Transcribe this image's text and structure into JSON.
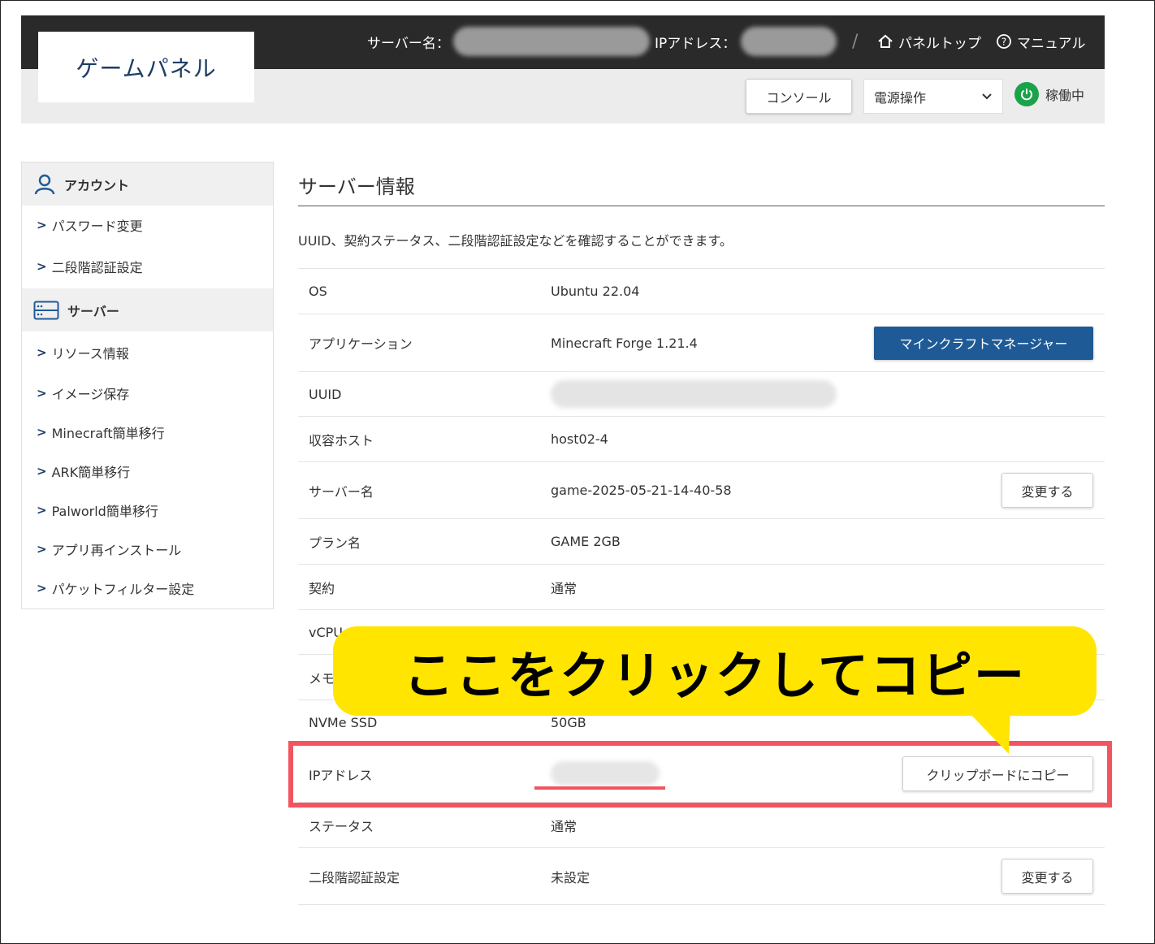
{
  "header": {
    "logo": "ゲームパネル",
    "server_name_label": "サーバー名：",
    "ip_label": "IPアドレス：",
    "panel_top": "パネルトップ",
    "manual": "マニュアル",
    "console_button": "コンソール",
    "power_select": "電源操作",
    "status_text": "稼働中",
    "colors": {
      "dark_bar": "#2a2a2a",
      "logo_text": "#1f3d66",
      "status_green": "#1aa34a"
    }
  },
  "sidebar": {
    "account_heading": "アカウント",
    "account_items": [
      "パスワード変更",
      "二段階認証設定"
    ],
    "server_heading": "サーバー",
    "server_items": [
      "リソース情報",
      "イメージ保存",
      "Minecraft簡単移行",
      "ARK簡単移行",
      "Palworld簡単移行",
      "アプリ再インストール",
      "パケットフィルター設定"
    ]
  },
  "main": {
    "title": "サーバー情報",
    "description": "UUID、契約ステータス、二段階認証設定などを確認することができます。",
    "rows": [
      {
        "key": "OS",
        "value": "Ubuntu 22.04"
      },
      {
        "key": "アプリケーション",
        "value": "Minecraft Forge 1.21.4",
        "button": "マインクラフトマネージャー"
      },
      {
        "key": "UUID",
        "value": ""
      },
      {
        "key": "収容ホスト",
        "value": "host02-4"
      },
      {
        "key": "サーバー名",
        "value": "game-2025-05-21-14-40-58",
        "button": "変更する"
      },
      {
        "key": "プラン名",
        "value": "GAME 2GB"
      },
      {
        "key": "契約",
        "value": "通常"
      },
      {
        "key": "vCPU",
        "value": ""
      },
      {
        "key": "メモリ",
        "value": ""
      },
      {
        "key": "NVMe SSD",
        "value": "50GB"
      },
      {
        "key": "IPアドレス",
        "value": "",
        "button": "クリップボードにコピー"
      },
      {
        "key": "ステータス",
        "value": "通常"
      },
      {
        "key": "二段階認証設定",
        "value": "未設定",
        "button": "変更する"
      }
    ],
    "accent_color": "#1e5a96"
  },
  "annotation": {
    "callout_text": "ここをクリックしてコピー",
    "callout_color": "#ffe500",
    "highlight_color": "#f25560"
  }
}
